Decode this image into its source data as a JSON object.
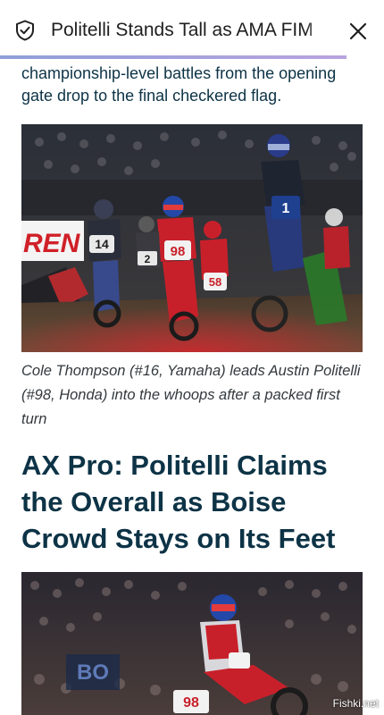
{
  "browser": {
    "tab_title": "Politelli Stands Tall as AMA FIM",
    "icons": {
      "site": "shield-check-icon",
      "close": "close-icon"
    },
    "accent_color": "#9aa4e0"
  },
  "article": {
    "intro_text": "championship-level battles from the opening gate drop to the final checkered flag.",
    "photo1": {
      "sign_text": "REN",
      "plates": [
        "14",
        "98",
        "1",
        "58",
        "2"
      ]
    },
    "caption": "Cole Thompson (#16, Yamaha) leads Austin Politelli (#98, Honda) into the whoops after a packed first turn",
    "headline": "AX Pro: Politelli Claims the Overall as Boise Crowd Stays on Its Feet",
    "photo2": {
      "sign_text": "BO",
      "plates": [
        "98"
      ]
    }
  },
  "watermark": "Fishki.net",
  "colors": {
    "headline": "#0d3346",
    "honda_red": "#c8202a",
    "yamaha_blue": "#1f3f8f"
  }
}
